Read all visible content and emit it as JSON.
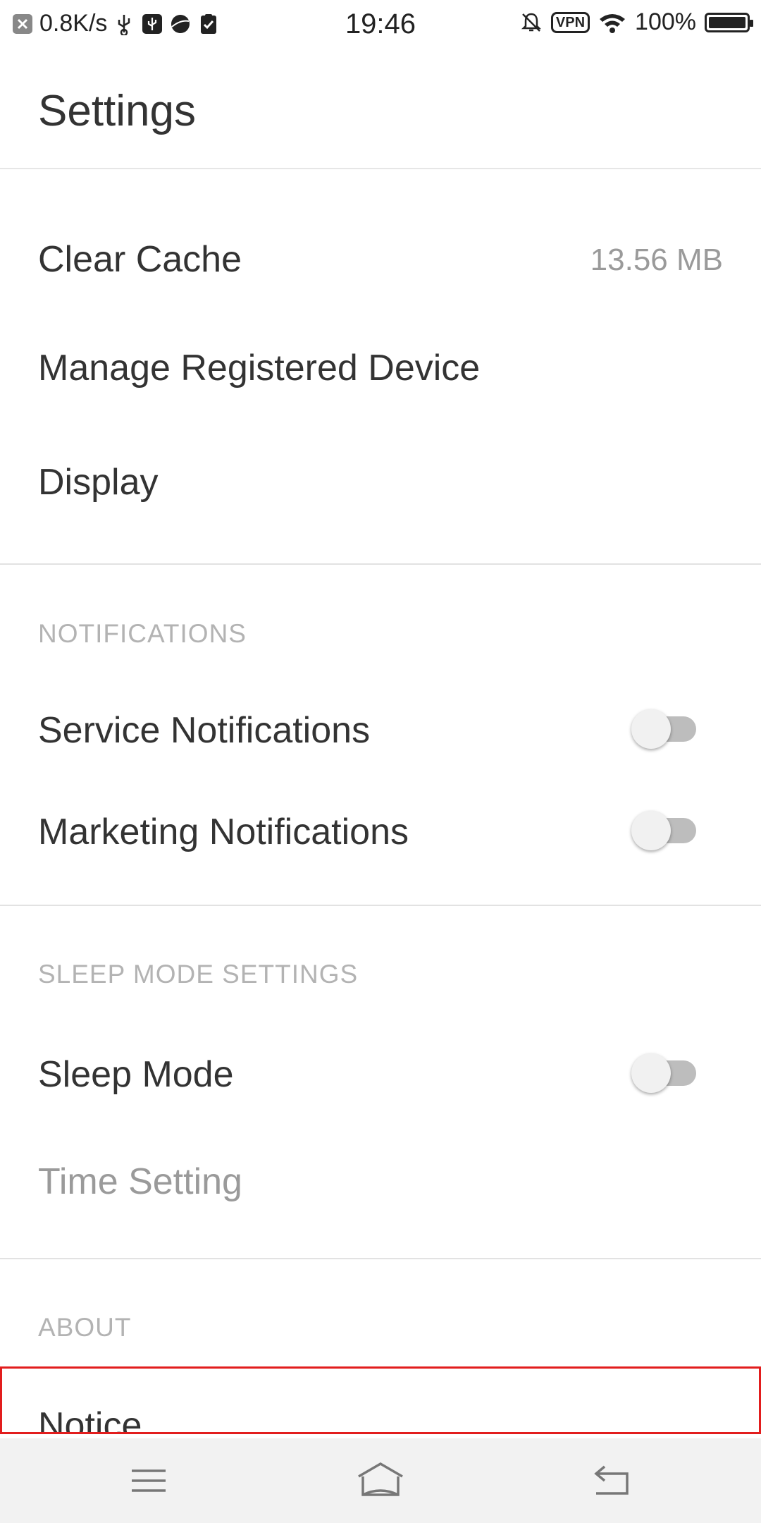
{
  "status_bar": {
    "net_speed": "0.8K/s",
    "time": "19:46",
    "vpn": "VPN",
    "battery": "100%",
    "battery_level": 1.0
  },
  "header": {
    "title": "Settings"
  },
  "general": {
    "clear_cache_label": "Clear Cache",
    "clear_cache_value": "13.56 MB",
    "manage_device_label": "Manage Registered Device",
    "display_label": "Display"
  },
  "notifications": {
    "section_title": "NOTIFICATIONS",
    "service_label": "Service Notifications",
    "service_on": false,
    "marketing_label": "Marketing Notifications",
    "marketing_on": false
  },
  "sleep": {
    "section_title": "SLEEP MODE SETTINGS",
    "sleep_mode_label": "Sleep Mode",
    "sleep_mode_on": false,
    "time_setting_label": "Time Setting"
  },
  "about": {
    "section_title": "ABOUT",
    "notice_label": "Notice"
  },
  "colors": {
    "highlight": "#e21d1d",
    "toggle_off_track": "#bdbdbd",
    "toggle_knob": "#f1f1f1"
  },
  "nav": {
    "menu_icon": "menu-icon",
    "home_icon": "home-icon",
    "back_icon": "back-icon"
  }
}
